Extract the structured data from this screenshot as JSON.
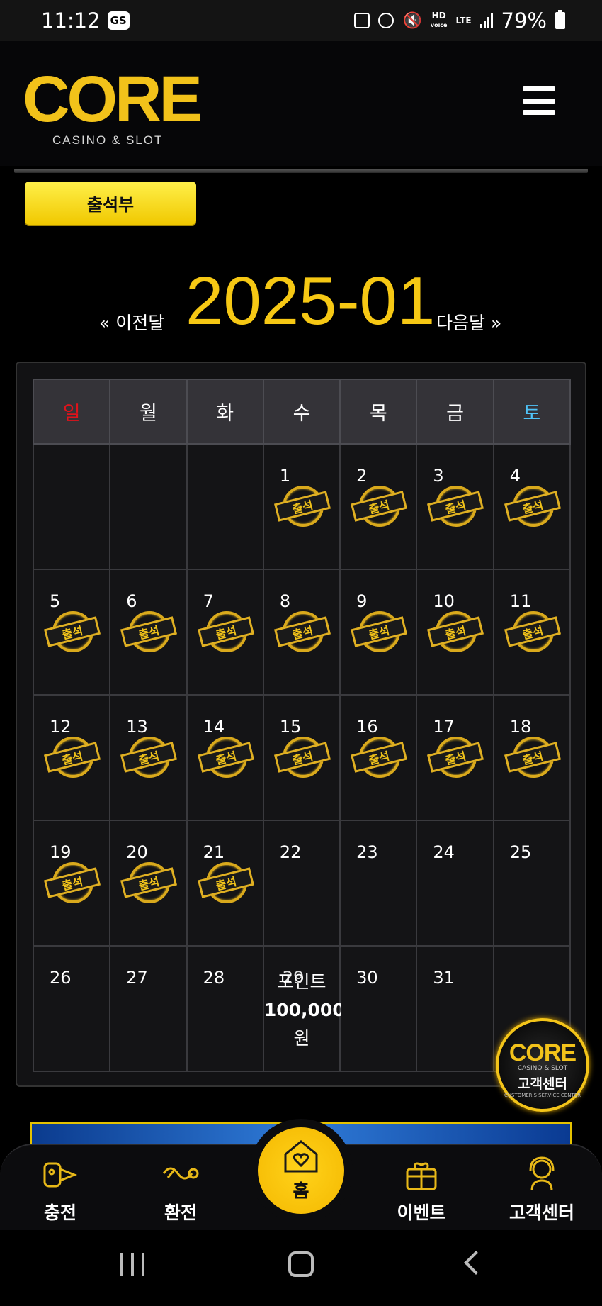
{
  "status_bar": {
    "time": "11:12",
    "carrier_badge": "GS",
    "hd_label": "HD",
    "hd_sub": "voice",
    "lte_label": "LTE",
    "battery_percent": "79%"
  },
  "header": {
    "logo_text": "CORE",
    "logo_subtitle": "CASINO & SLOT",
    "menu_icon": "hamburger-menu-icon"
  },
  "attendance_button": {
    "label": "출석부"
  },
  "month_nav": {
    "prev_label": "« 이전달",
    "current_month": "2025-01",
    "next_label": "다음달 »"
  },
  "calendar": {
    "weekdays": [
      "일",
      "월",
      "화",
      "수",
      "목",
      "금",
      "토"
    ],
    "stamp_text": "출석",
    "weeks": [
      [
        {
          "day": ""
        },
        {
          "day": ""
        },
        {
          "day": ""
        },
        {
          "day": "1",
          "stamp": true
        },
        {
          "day": "2",
          "stamp": true
        },
        {
          "day": "3",
          "stamp": true
        },
        {
          "day": "4",
          "stamp": true
        }
      ],
      [
        {
          "day": "5",
          "stamp": true
        },
        {
          "day": "6",
          "stamp": true
        },
        {
          "day": "7",
          "stamp": true
        },
        {
          "day": "8",
          "stamp": true
        },
        {
          "day": "9",
          "stamp": true
        },
        {
          "day": "10",
          "stamp": true
        },
        {
          "day": "11",
          "stamp": true
        }
      ],
      [
        {
          "day": "12",
          "stamp": true
        },
        {
          "day": "13",
          "stamp": true
        },
        {
          "day": "14",
          "stamp": true
        },
        {
          "day": "15",
          "stamp": true
        },
        {
          "day": "16",
          "stamp": true
        },
        {
          "day": "17",
          "stamp": true
        },
        {
          "day": "18",
          "stamp": true
        }
      ],
      [
        {
          "day": "19",
          "stamp": true
        },
        {
          "day": "20",
          "stamp": true
        },
        {
          "day": "21",
          "stamp": true
        },
        {
          "day": "22"
        },
        {
          "day": "23"
        },
        {
          "day": "24"
        },
        {
          "day": "25"
        }
      ],
      [
        {
          "day": "26"
        },
        {
          "day": "27"
        },
        {
          "day": "28"
        },
        {
          "day": "29",
          "bonus": true
        },
        {
          "day": "30"
        },
        {
          "day": "31"
        },
        {
          "day": ""
        }
      ]
    ],
    "bonus": {
      "label": "포인트",
      "amount": "100,000",
      "unit": "원"
    }
  },
  "customer_center_badge": {
    "logo_text": "CORE",
    "logo_subtitle": "CASINO & SLOT",
    "label": "고객센터",
    "sub_label": "CUSTOMER'S SERVICE CENTER"
  },
  "bottom_nav": {
    "items": [
      {
        "label": "충전",
        "icon": "deposit-icon"
      },
      {
        "label": "환전",
        "icon": "withdraw-icon"
      },
      {
        "label": "홈",
        "icon": "home-heart-icon"
      },
      {
        "label": "이벤트",
        "icon": "gift-icon"
      },
      {
        "label": "고객센터",
        "icon": "support-agent-icon"
      }
    ]
  },
  "colors": {
    "accent_yellow": "#f6c814",
    "sunday_red": "#e0131b",
    "saturday_blue": "#4fc3f7",
    "background": "#000000"
  }
}
